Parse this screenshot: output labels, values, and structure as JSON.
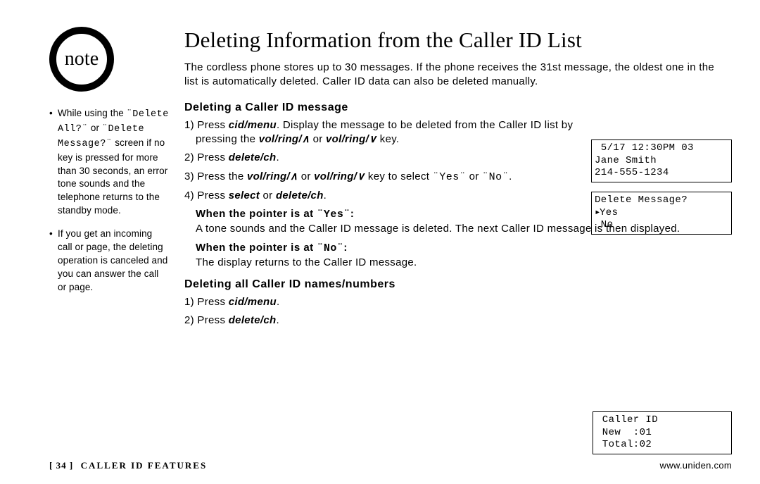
{
  "note": {
    "label": "note",
    "item1_a": "While using the ",
    "item1_lcd1": "¨Delete All?¨",
    "item1_b": " or ",
    "item1_lcd2": "¨Delete Message?¨",
    "item1_c": " screen if no key is pressed for more than 30 seconds, an error tone sounds and the telephone returns to the standby mode.",
    "item2": "If you get an incoming call or page, the deleting operation is canceled and you can answer the call or page."
  },
  "main": {
    "title": "Deleting Information from the Caller ID List",
    "intro": "The cordless phone stores up to 30 messages. If the phone receives the 31st message, the oldest one in the list is automatically deleted. Caller ID data can also be deleted manually.",
    "h2a": "Deleting a Caller ID message",
    "s1_a": "1) Press ",
    "s1_b": "cid/menu",
    "s1_c": ". Display the message to be deleted from the Caller ID list by pressing the ",
    "s1_d": "vol/ring/∧",
    "s1_e": " or ",
    "s1_f": "vol/ring/∨",
    "s1_g": " key.",
    "s2_a": "2) Press ",
    "s2_b": "delete/ch",
    "s2_c": ".",
    "s3_a": "3) Press the ",
    "s3_b": "vol/ring/∧",
    "s3_c": " or ",
    "s3_d": "vol/ring/∨",
    "s3_e": " key to select ",
    "s3_yes": "¨Yes¨",
    "s3_or": " or ",
    "s3_no": "¨No¨",
    "s3_f": ".",
    "s4_a": "4) Press ",
    "s4_b": "select",
    "s4_c": " or ",
    "s4_d": "delete/ch",
    "s4_e": ".",
    "yes_head_a": "When the pointer is at ",
    "yes_head_b": "¨Yes¨",
    "yes_head_c": ":",
    "yes_body": "A tone sounds and the Caller ID message is deleted. The next Caller ID message is then displayed.",
    "no_head_a": "When the pointer is at ",
    "no_head_b": "¨No¨",
    "no_head_c": ":",
    "no_body": "The display returns to the Caller ID message.",
    "h2b": "Deleting all Caller ID names/numbers",
    "b1_a": "1) Press ",
    "b1_b": "cid/menu",
    "b1_c": ".",
    "b2_a": "2) Press ",
    "b2_b": "delete/ch",
    "b2_c": "."
  },
  "screens": {
    "s1_l1": " 5/17 12:30PM 03",
    "s1_l2": "Jane Smith",
    "s1_l3": "214-555-1234",
    "s2_l1": "Delete Message?",
    "s2_l2_ptr": "▸",
    "s2_l2": "Yes",
    "s2_l3": " No",
    "s3_l1": " Caller ID",
    "s3_l2": " New  :01",
    "s3_l3": " Total:02"
  },
  "footer": {
    "page": "[ 34 ]",
    "section": "CALLER ID FEATURES",
    "url": "www.uniden.com"
  }
}
